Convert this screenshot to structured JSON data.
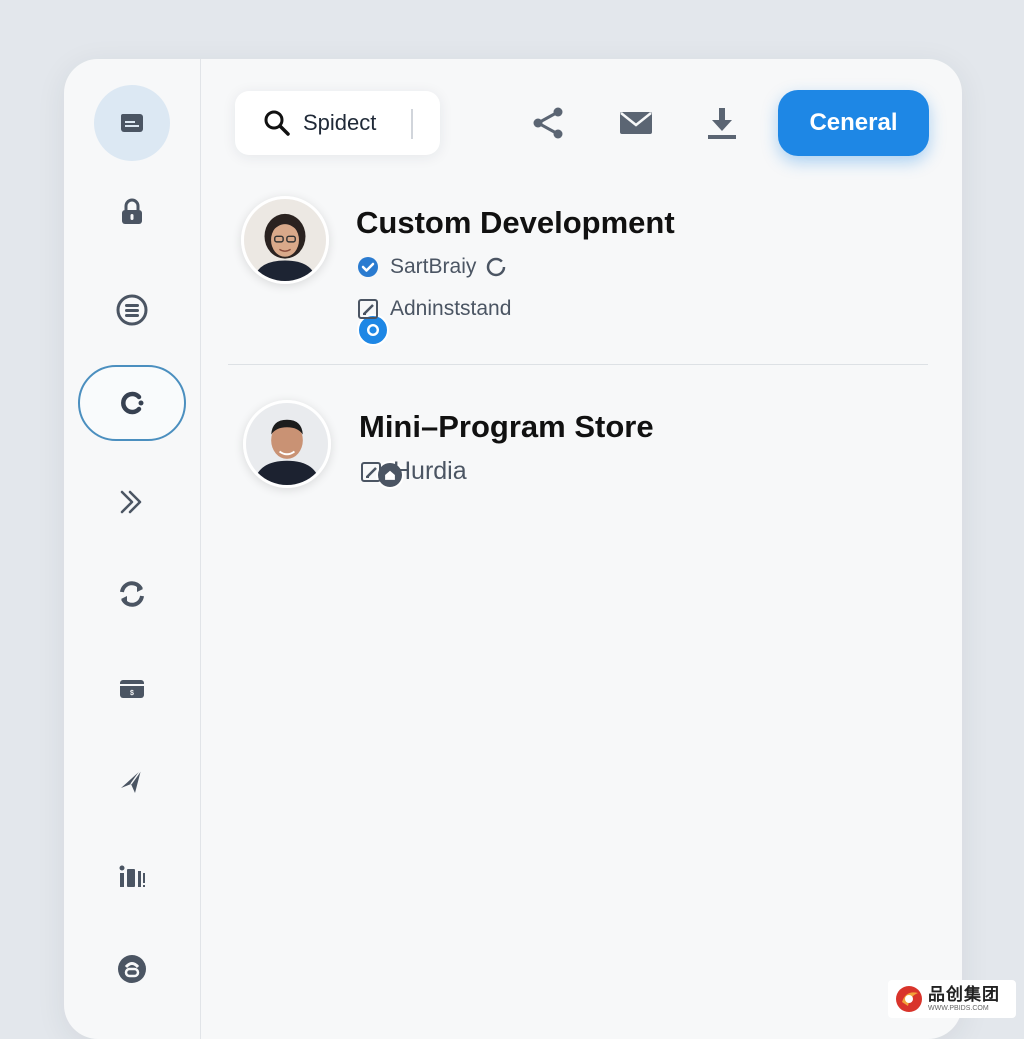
{
  "header": {
    "search": {
      "value": "Spidect"
    },
    "tools": [
      {
        "icon": "share-icon"
      },
      {
        "icon": "mail-icon"
      },
      {
        "icon": "download-icon"
      }
    ],
    "primary_button_label": "Ceneral"
  },
  "sidebar": {
    "items": [
      {
        "icon": "folder-icon",
        "state": "selected"
      },
      {
        "icon": "lock-icon"
      },
      {
        "icon": "list-icon"
      },
      {
        "icon": "refresh-icon",
        "state": "focused"
      },
      {
        "icon": "double-chevron-right-icon"
      },
      {
        "icon": "sync-icon"
      },
      {
        "icon": "wallet-icon"
      },
      {
        "icon": "send-icon"
      },
      {
        "icon": "stats-icon"
      },
      {
        "icon": "circle-b-icon"
      }
    ]
  },
  "list": {
    "items": [
      {
        "title": "Custom Development",
        "meta": [
          {
            "icon": "verified-icon",
            "text": "SartBraiy"
          },
          {
            "icon": "edit-icon",
            "text": "Adninststand"
          }
        ]
      },
      {
        "title": "Mini–Program Store",
        "meta": [
          {
            "icon": "edit-icon",
            "text": "Hurdia"
          }
        ]
      }
    ]
  },
  "watermark": {
    "text": "品创集团",
    "subtext": "WWW.PBIDS.COM"
  },
  "colors": {
    "accent": "#1e87e5",
    "background": "#e3e7ec",
    "panel": "#f7f8f9"
  }
}
